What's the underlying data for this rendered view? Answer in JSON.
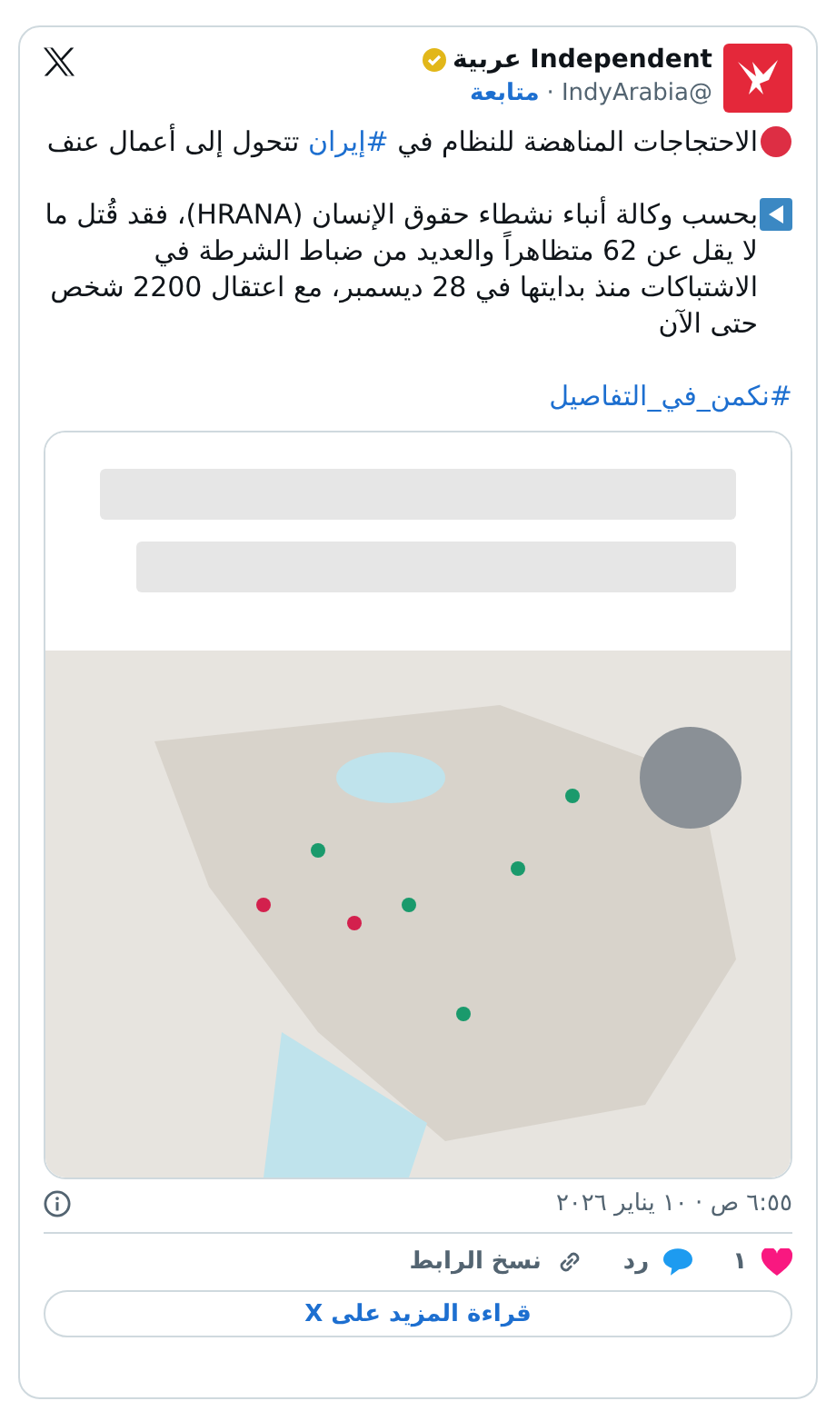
{
  "author": {
    "name": "Independent عربية",
    "verified": true,
    "handle": "@IndyArabia",
    "separator": "·",
    "follow": "متابعة"
  },
  "paragraphs": [
    {
      "segments": [
        {
          "kind": "text",
          "text": "الاحتجاجات المناهضة للنظام في "
        },
        {
          "kind": "hashtag",
          "text": "#إيران"
        },
        {
          "kind": "text",
          "text": " تتحول إلى أعمال عنف"
        }
      ]
    },
    {
      "segments": [
        {
          "kind": "text",
          "text": "بحسب وكالة أنباء نشطاء حقوق الإنسان (HRANA)، فقد قُتل ما لا يقل عن 62 متظاهراً والعديد من ضباط الشرطة في الاشتباكات منذ بدايتها في 28 ديسمبر، مع اعتقال 2200 شخص حتى الآن"
        }
      ]
    },
    {
      "segments": [
        {
          "kind": "hashtag",
          "text": "#نكمن_في_التفاصيل"
        }
      ]
    }
  ],
  "timestamp": "٦:٥٥ ص · ١٠ يناير ٢٠٢٦",
  "actions": [
    {
      "kind": "like",
      "label": "١"
    },
    {
      "kind": "reply",
      "label": "رد"
    },
    {
      "kind": "copy-link",
      "label": "نسخ الرابط"
    }
  ],
  "read_more": "قراءة المزيد على X"
}
